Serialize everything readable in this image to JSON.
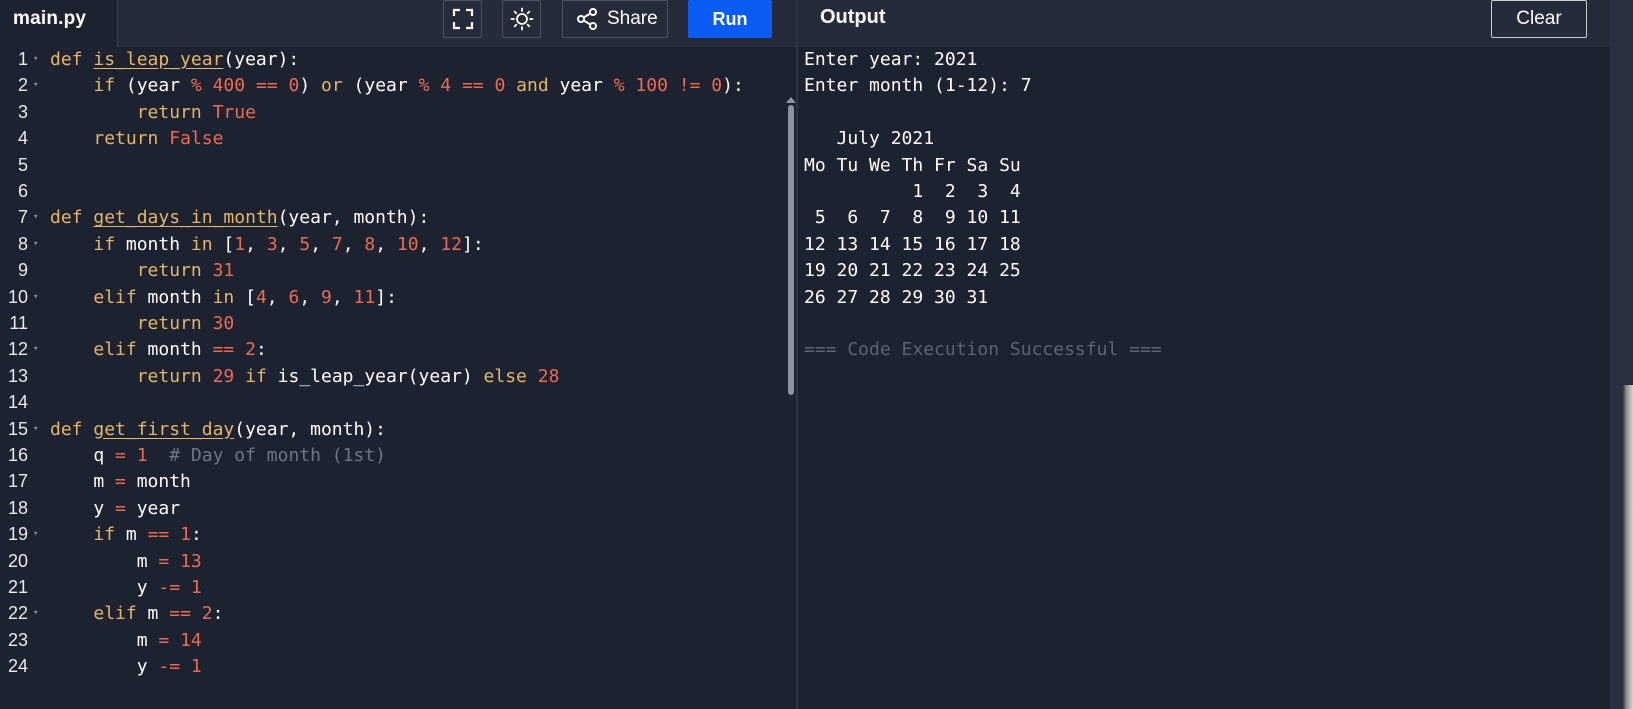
{
  "header": {
    "file_name": "main.py",
    "fullscreen_icon": "fullscreen-icon",
    "theme_icon": "sun-icon",
    "share_label": "Share",
    "share_icon": "share-icon",
    "run_label": "Run",
    "output_title": "Output",
    "clear_label": "Clear"
  },
  "colors": {
    "background": "#1d2230",
    "header": "#252b38",
    "run_button": "#0a5cf5",
    "keyword": "#e5b567",
    "number": "#ee6a52",
    "comment": "#6e7585"
  },
  "editor": {
    "lines": [
      {
        "n": "1",
        "text": "def is_leap_year(year):"
      },
      {
        "n": "2",
        "text": "    if (year % 400 == 0) or (year % 4 == 0 and year % 100 != 0):"
      },
      {
        "n": "3",
        "text": "        return True"
      },
      {
        "n": "4",
        "text": "    return False"
      },
      {
        "n": "5",
        "text": ""
      },
      {
        "n": "6",
        "text": ""
      },
      {
        "n": "7",
        "text": "def get_days_in_month(year, month):"
      },
      {
        "n": "8",
        "text": "    if month in [1, 3, 5, 7, 8, 10, 12]:"
      },
      {
        "n": "9",
        "text": "        return 31"
      },
      {
        "n": "10",
        "text": "    elif month in [4, 6, 9, 11]:"
      },
      {
        "n": "11",
        "text": "        return 30"
      },
      {
        "n": "12",
        "text": "    elif month == 2:"
      },
      {
        "n": "13",
        "text": "        return 29 if is_leap_year(year) else 28"
      },
      {
        "n": "14",
        "text": ""
      },
      {
        "n": "15",
        "text": "def get_first_day(year, month):"
      },
      {
        "n": "16",
        "text": "    q = 1  # Day of month (1st)"
      },
      {
        "n": "17",
        "text": "    m = month"
      },
      {
        "n": "18",
        "text": "    y = year"
      },
      {
        "n": "19",
        "text": "    if m == 1:"
      },
      {
        "n": "20",
        "text": "        m = 13"
      },
      {
        "n": "21",
        "text": "        y -= 1"
      },
      {
        "n": "22",
        "text": "    elif m == 2:"
      },
      {
        "n": "23",
        "text": "        m = 14"
      },
      {
        "n": "24",
        "text": "        y -= 1"
      }
    ]
  },
  "output": {
    "lines": [
      "Enter year: 2021",
      "Enter month (1-12): 7",
      "",
      "   July 2021",
      "Mo Tu We Th Fr Sa Su",
      "          1  2  3  4",
      " 5  6  7  8  9 10 11",
      "12 13 14 15 16 17 18",
      "19 20 21 22 23 24 25",
      "26 27 28 29 30 31",
      "",
      "=== Code Execution Successful ==="
    ]
  }
}
